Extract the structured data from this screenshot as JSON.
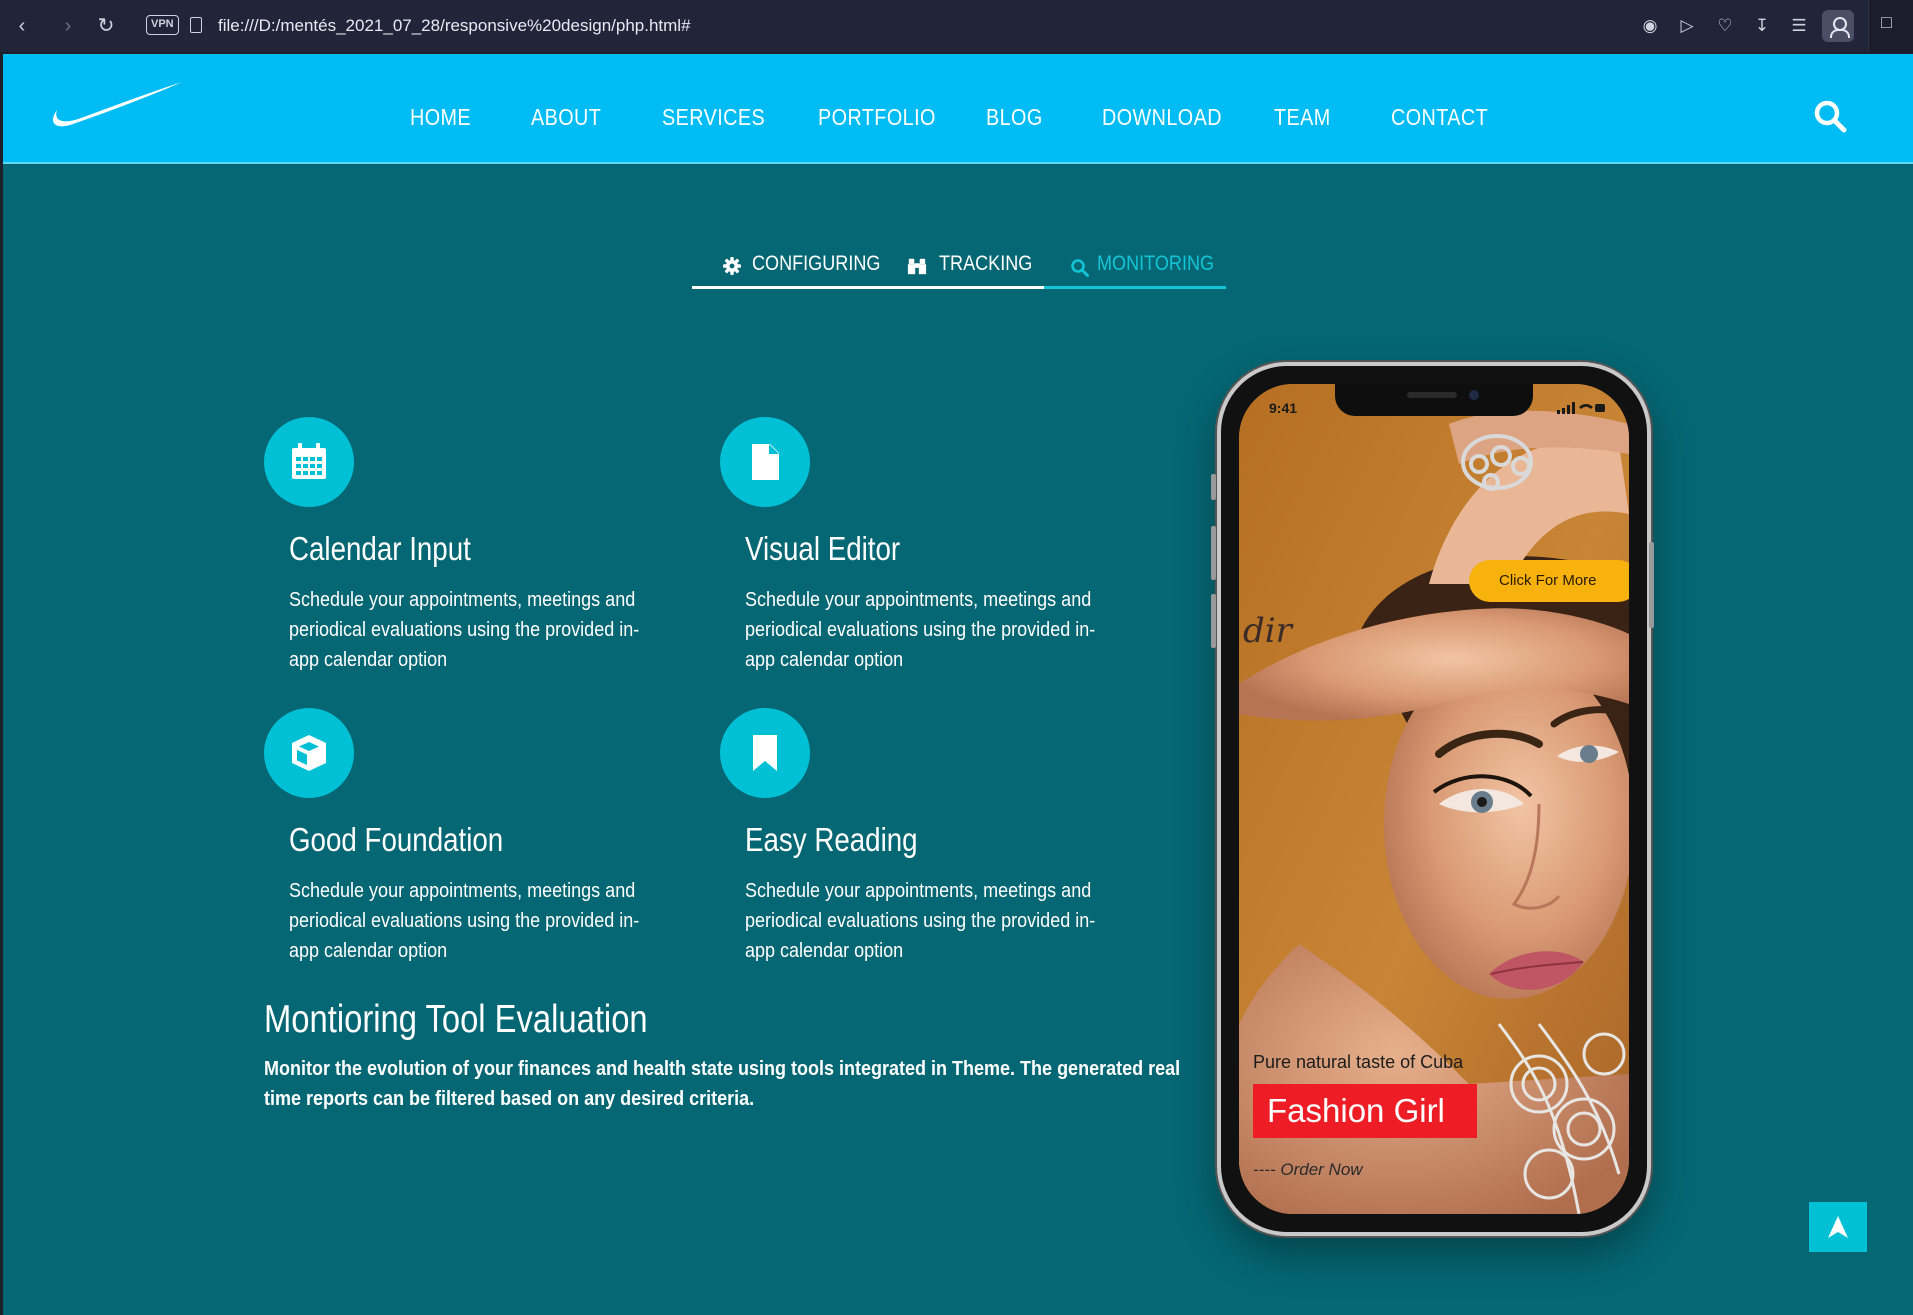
{
  "browser": {
    "url": "file:///D:/mentés_2021_07_28/responsive%20design/php.html#",
    "vpn_label": "VPN"
  },
  "header": {
    "brand_color": "#00bcf5",
    "nav": [
      "HOME",
      "ABOUT",
      "SERVICES",
      "PORTFOLIO",
      "BLOG",
      "DOWNLOAD",
      "TEAM",
      "CONTACT"
    ]
  },
  "tabs": {
    "items": [
      {
        "label": "CONFIGURING",
        "icon": "gear-icon",
        "active": false
      },
      {
        "label": "TRACKING",
        "icon": "binoculars-icon",
        "active": false
      },
      {
        "label": "MONITORING",
        "icon": "search-icon",
        "active": true
      }
    ],
    "active_color": "#13c4d8"
  },
  "features": [
    {
      "title": "Calendar Input",
      "icon": "calendar-icon",
      "text": "Schedule your appointments, meetings and periodical evaluations using the provided in-app calendar option"
    },
    {
      "title": "Visual Editor",
      "icon": "document-icon",
      "text": "Schedule your appointments, meetings and periodical evaluations using the provided in-app calendar option"
    },
    {
      "title": "Good Foundation",
      "icon": "cube-icon",
      "text": "Schedule your appointments, meetings and periodical evaluations using the provided in-app calendar option"
    },
    {
      "title": "Easy Reading",
      "icon": "bookmark-icon",
      "text": "Schedule your appointments, meetings and periodical evaluations using the provided in-app calendar option"
    }
  ],
  "evaluation": {
    "title": "Montioring Tool Evaluation",
    "text": "Monitor the evolution of your finances and health state using tools integrated in Theme. The generated real time reports can be filtered based on any desired criteria."
  },
  "phone": {
    "time": "9:41",
    "cta": "Click For More",
    "subtitle": "Pure natural taste of Cuba",
    "title": "Fashion Girl",
    "order": "Order Now"
  },
  "colors": {
    "page_bg": "#056773",
    "accent": "#00c0d6",
    "cta": "#f7b20e",
    "promo_red": "#ee1c24"
  }
}
